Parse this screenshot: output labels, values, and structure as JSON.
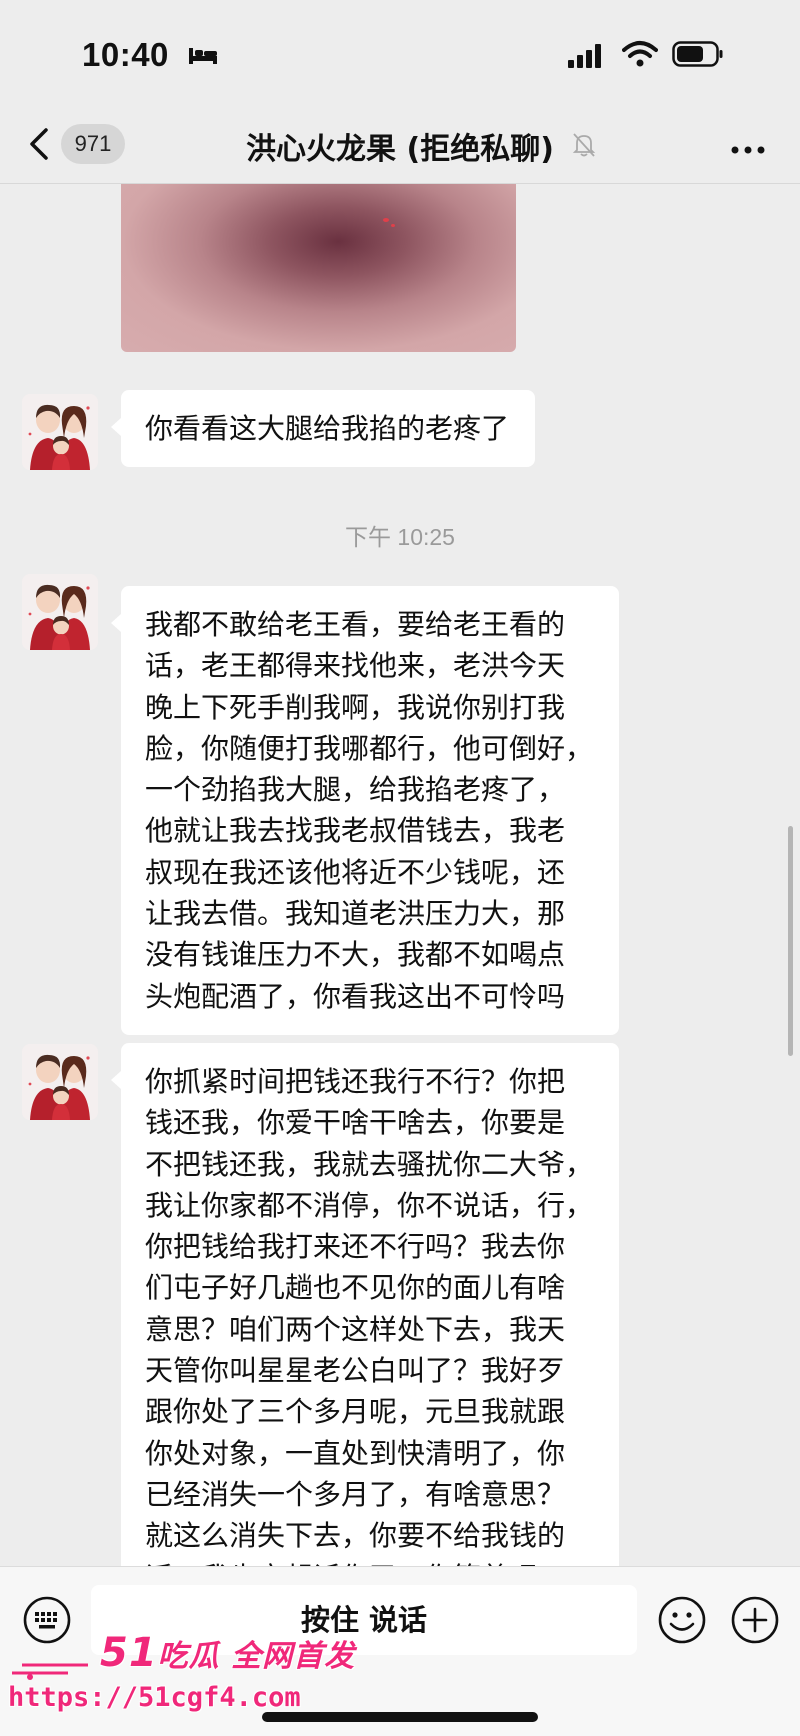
{
  "status_bar": {
    "time": "10:40",
    "icons": [
      "bed-icon",
      "signal-icon",
      "wifi-icon",
      "battery-icon"
    ]
  },
  "nav": {
    "back_icon": "chevron-left-icon",
    "unread_count": "971",
    "title": "洪心火龙果 (拒绝私聊)",
    "mute_icon": "bell-muted-icon",
    "more_icon": "ellipsis-icon"
  },
  "messages": [
    {
      "type": "image",
      "description": "photo"
    },
    {
      "type": "text",
      "lines": [
        "你看看这大腿给我掐的老疼了"
      ]
    },
    {
      "type": "time",
      "text": "下午 10:25"
    },
    {
      "type": "text",
      "lines": [
        "我都不敢给老王看，要给老王看的",
        "话，老王都得来找他来，老洪今天",
        "晚上下死手削我啊，我说你别打我",
        "脸，你随便打我哪都行，他可倒好，",
        "一个劲掐我大腿，给我掐老疼了，",
        "他就让我去找我老叔借钱去，我老",
        "叔现在我还该他将近不少钱呢，还",
        "让我去借。我知道老洪压力大，那",
        "没有钱谁压力不大，我都不如喝点",
        "头炮配酒了，你看我这出不可怜吗"
      ]
    },
    {
      "type": "text",
      "lines": [
        "你抓紧时间把钱还我行不行？你把",
        "钱还我，你爱干啥干啥去，你要是",
        "不把钱还我，我就去骚扰你二大爷，",
        "我让你家都不消停，你不说话，行，",
        "你把钱给我打来还不行吗？我去你",
        "们屯子好几趟也不见你的面儿有啥",
        "意思？咱们两个这样处下去，我天",
        "天管你叫星星老公白叫了？我好歹",
        "跟你处了三个多月呢，元旦我就跟",
        "你处对象，一直处到快清明了，你",
        "已经消失一个多月了，有啥意思？",
        "就这么消失下去，你要不给我钱的",
        "话，我肯定起诉你了。你等着吧"
      ]
    }
  ],
  "input_bar": {
    "keyboard_icon": "keyboard-icon",
    "voice_label": "按住 说话",
    "emoji_icon": "smiley-icon",
    "plus_icon": "plus-circle-icon"
  },
  "watermark": {
    "brand_num": "51",
    "brand_text": "吃瓜 全网首发",
    "url": "https://51cgf4.com",
    "color": "#f0287a"
  }
}
